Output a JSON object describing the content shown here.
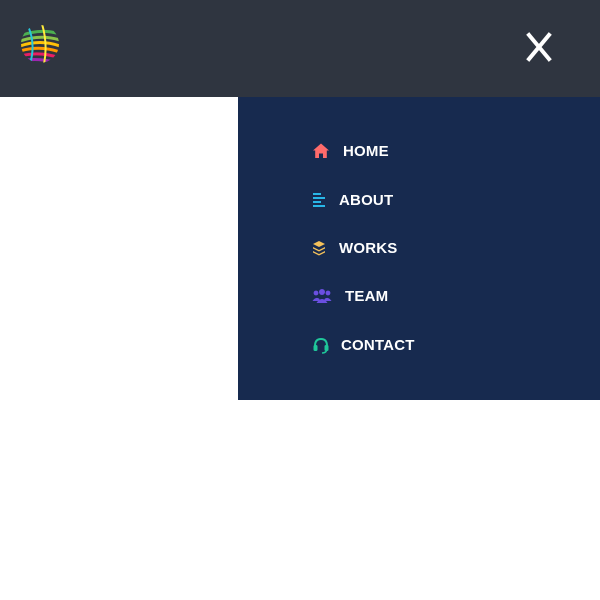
{
  "header": {
    "logo_icon": "globe-logo-icon",
    "close_icon": "close-icon"
  },
  "menu": {
    "items": [
      {
        "label": "HOME",
        "icon": "home-icon",
        "color": "#ff6b6b"
      },
      {
        "label": "ABOUT",
        "icon": "align-left-icon",
        "color": "#29b6e8"
      },
      {
        "label": "WORKS",
        "icon": "layers-icon",
        "color": "#f5c15a"
      },
      {
        "label": "TEAM",
        "icon": "users-icon",
        "color": "#6a4fe0"
      },
      {
        "label": "CONTACT",
        "icon": "headset-icon",
        "color": "#1fc79a"
      }
    ]
  },
  "colors": {
    "topbar": "#2f3540",
    "menu_panel": "#172a4f",
    "menu_text": "#ffffff"
  }
}
